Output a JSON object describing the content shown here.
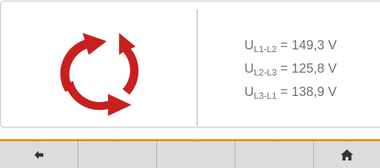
{
  "readings": {
    "l1_l2": {
      "symbol": "U",
      "sub": "L1-L2",
      "value": "= 149,3 V"
    },
    "l2_l3": {
      "symbol": "U",
      "sub": "L2-L3",
      "value": "= 125,8 V"
    },
    "l3_l1": {
      "symbol": "U",
      "sub": "L3-L1",
      "value": "= 138,9 V"
    }
  },
  "icons": {
    "rotation": "phase-rotation-icon",
    "back": "back-arrow-icon",
    "home": "home-icon"
  },
  "colors": {
    "rotation_arrows": "#c8201f",
    "nav_accent": "#f08a18",
    "nav_background": "#dcdcdc",
    "reading_text": "#707070"
  }
}
